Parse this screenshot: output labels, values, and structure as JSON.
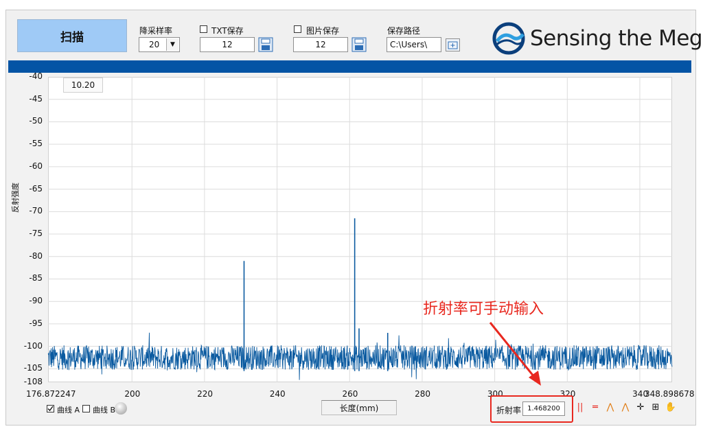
{
  "toolbar": {
    "scan_label": "扫描",
    "downsample_label": "降采样率",
    "downsample_value": "20",
    "txt_save_label": "TXT保存",
    "txt_value": "12",
    "img_save_label": "图片保存",
    "img_value": "12",
    "path_label": "保存路径",
    "path_value": "C:\\Users\\"
  },
  "logo": {
    "text": "Sensing the Mega"
  },
  "annotation": {
    "text": "折射率可手动输入"
  },
  "bottom": {
    "curve_a": "曲线 A",
    "curve_b": "曲线 B",
    "xlabel": "长度(mm)",
    "refractive_label": "折射率",
    "refractive_value": "1.468200"
  },
  "cursor_value": "10.20",
  "colors": {
    "accent": "#0454a5",
    "annotation": "#e8281f",
    "trace": "#0a5aa0"
  },
  "chart_data": {
    "type": "line",
    "ylabel": "反射强度",
    "xlabel": "长度(mm)",
    "xlim": [
      176.872247,
      348.898678
    ],
    "ylim": [
      -108,
      -40
    ],
    "x_ticks": [
      "176.872247",
      "200",
      "220",
      "240",
      "260",
      "280",
      "300",
      "320",
      "340",
      "348.898678"
    ],
    "y_ticks": [
      "-40",
      "-45",
      "-50",
      "-55",
      "-60",
      "-65",
      "-70",
      "-75",
      "-80",
      "-85",
      "-90",
      "-95",
      "-100",
      "-105",
      "-108"
    ],
    "grid": true,
    "series": [
      {
        "name": "曲线 A",
        "noise_floor": -102.5,
        "peaks": [
          {
            "x": 230.9,
            "y": -81
          },
          {
            "x": 261.4,
            "y": -71.5
          },
          {
            "x": 262.6,
            "y": -96
          },
          {
            "x": 270.5,
            "y": -97
          }
        ]
      }
    ]
  }
}
